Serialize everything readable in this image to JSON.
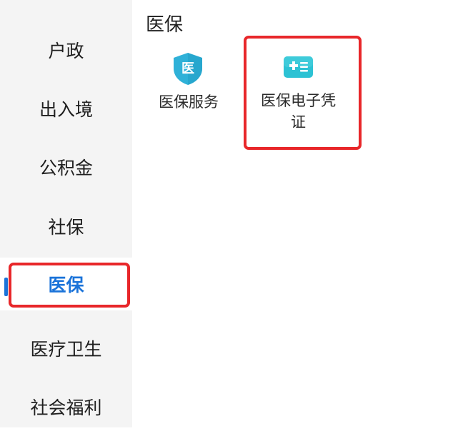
{
  "sidebar": {
    "items": [
      {
        "label": "户政"
      },
      {
        "label": "出入境"
      },
      {
        "label": "公积金"
      },
      {
        "label": "社保"
      },
      {
        "label": "医保",
        "active": true
      },
      {
        "label": "医疗卫生"
      },
      {
        "label": "社会福利"
      }
    ]
  },
  "section": {
    "title": "医保",
    "tiles": [
      {
        "label": "医保服务",
        "icon": "medical-insurance-shield-icon",
        "icon_text": "医",
        "color": "#2fb1d8"
      },
      {
        "label": "医保电子凭证",
        "icon": "medical-insurance-card-icon",
        "color": "#2cc2d4"
      }
    ]
  },
  "colors": {
    "accent": "#1a73d9",
    "highlight": "#e8272a",
    "sidebar_bg": "#f4f4f4"
  }
}
